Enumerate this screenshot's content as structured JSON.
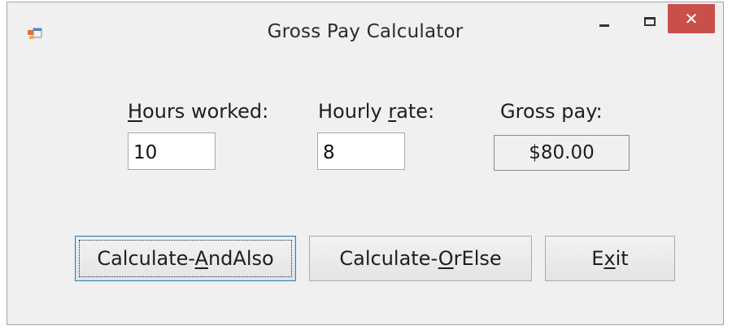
{
  "window": {
    "title": "Gross Pay Calculator",
    "accent_close_color": "#c9504a",
    "icons": {
      "app": "app-form-icon",
      "minimize": "minimize-icon",
      "maximize": "maximize-icon",
      "close": "close-icon"
    },
    "close_glyph": "✕"
  },
  "form": {
    "hours": {
      "label_access_key": "H",
      "label_rest": "ours worked:",
      "value": "10"
    },
    "rate": {
      "label_before": "Hourly ",
      "label_access_key": "r",
      "label_after": "ate:",
      "value": "8"
    },
    "gross": {
      "label": "Gross pay:",
      "value": "$80.00"
    }
  },
  "buttons": {
    "and_also": {
      "before": "Calculate-",
      "access_key": "A",
      "after": "ndAlso"
    },
    "or_else": {
      "before": "Calculate-",
      "access_key": "O",
      "after": "rElse"
    },
    "exit": {
      "before": "E",
      "access_key": "x",
      "after": "it"
    }
  }
}
